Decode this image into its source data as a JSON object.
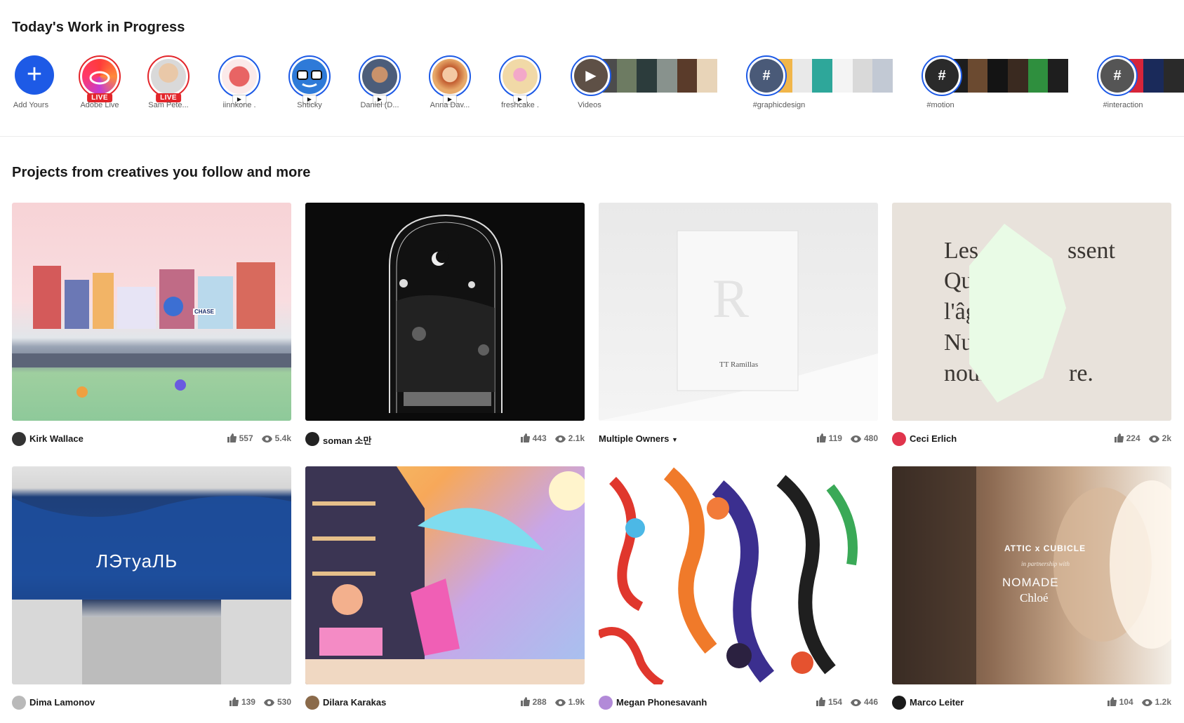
{
  "wip": {
    "title": "Today's Work in Progress",
    "stories": [
      {
        "label": "Add Yours",
        "type": "add"
      },
      {
        "label": "Adobe Live",
        "type": "live",
        "badge": "LIVE",
        "color": "#e53f3f"
      },
      {
        "label": "Sam Pete...",
        "type": "live",
        "badge": "LIVE",
        "color": "#c9b9a8"
      },
      {
        "label": "iinnkone .",
        "type": "video",
        "color": "#e86464"
      },
      {
        "label": "Shticky",
        "type": "video",
        "color": "#2e7ad8"
      },
      {
        "label": "Daniel (D...",
        "type": "video",
        "color": "#4c5d7a"
      },
      {
        "label": "Anna Dav...",
        "type": "video",
        "color": "#e7a96a"
      },
      {
        "label": "freshcake .",
        "type": "video",
        "color": "#f1d9a7"
      },
      {
        "label": "Videos",
        "type": "collection",
        "color": "#6e6e6e"
      },
      {
        "label": "#graphicdesign",
        "type": "hashtag"
      },
      {
        "label": "#motion",
        "type": "hashtag"
      },
      {
        "label": "#interaction",
        "type": "hashtag"
      }
    ]
  },
  "projects": {
    "title": "Projects from creatives you follow and more",
    "cards": [
      {
        "owner": "Kirk Wallace",
        "likes": "557",
        "views": "5.4k"
      },
      {
        "owner": "soman 소만",
        "likes": "443",
        "views": "2.1k"
      },
      {
        "owner": "Multiple Owners",
        "likes": "119",
        "views": "480"
      },
      {
        "owner": "Ceci Erlich",
        "likes": "224",
        "views": "2k"
      },
      {
        "owner": "Dima Lamonov",
        "likes": "139",
        "views": "530"
      },
      {
        "owner": "Dilara Karakas",
        "likes": "288",
        "views": "1.9k"
      },
      {
        "owner": "Megan Phonesavanh",
        "likes": "154",
        "views": "446"
      },
      {
        "owner": "Marco Leiter",
        "likes": "104",
        "views": "1.2k"
      }
    ]
  },
  "cover_text": {
    "chase": "CHASE",
    "tt_ramillas": "TT Ramillas",
    "r_letter": "R",
    "poem_lines": [
      "Les",
      "ssent",
      "Qu",
      "l'âg",
      "Nu",
      "nous",
      "re."
    ],
    "etuale": "ЛЭтуаЛЬ",
    "attic": "ATTIC x CUBICLE",
    "partnership": "in partnership with",
    "nomade": "NOMADE",
    "chloe": "Chloé"
  },
  "colors": {
    "accent": "#1d5ae6",
    "live": "#e3262b"
  }
}
